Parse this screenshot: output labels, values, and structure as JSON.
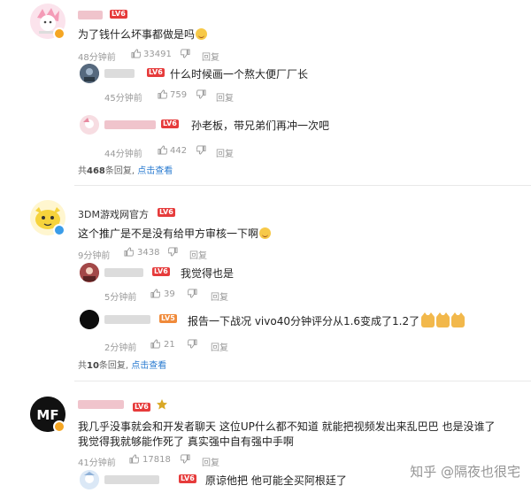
{
  "thread1": {
    "comment": "为了钱什么坏事都做是吗",
    "time": "48分钟前",
    "likes": "33491",
    "reply_label": "回复",
    "replies": [
      {
        "text": "什么时候画一个熬大便厂厂长",
        "time": "45分钟前",
        "likes": "759",
        "reply_label": "回复",
        "level": "LV6"
      },
      {
        "text": "孙老板，带兄弟们再冲一次吧",
        "time": "44分钟前",
        "likes": "442",
        "reply_label": "回复",
        "level": "LV6"
      }
    ],
    "level": "LV6",
    "summary_prefix": "共",
    "summary_count": "468",
    "summary_suffix": "条回复,",
    "summary_link": "点击查看"
  },
  "thread2": {
    "username": "3DM游戏网官方",
    "level": "LV6",
    "comment": "这个推广是不是没有给甲方审核一下啊",
    "time": "9分钟前",
    "likes": "3438",
    "reply_label": "回复",
    "replies": [
      {
        "text": "我觉得也是",
        "time": "5分钟前",
        "likes": "39",
        "reply_label": "回复",
        "level": "LV6"
      },
      {
        "text": "报告一下战况 vivo40分钟评分从1.6变成了1.2了",
        "time": "2分钟前",
        "likes": "21",
        "reply_label": "回复",
        "level": "LV5"
      }
    ],
    "summary_prefix": "共",
    "summary_count": "10",
    "summary_suffix": "条回复,",
    "summary_link": "点击查看"
  },
  "thread3": {
    "level": "LV6",
    "comment_line1": "我几乎没事就会和开发者聊天   这位UP什么都不知道 就能把视频发出来乱巴巴   也是没谁了",
    "comment_line2": "我觉得我就够能作死了  真实强中自有强中手啊",
    "time": "41分钟前",
    "likes": "17818",
    "reply_label": "回复",
    "avatar_text": "MF",
    "replies": [
      {
        "text": "原谅他把 他可能全买阿根廷了",
        "level": "LV6"
      }
    ]
  },
  "watermark": "知乎 @隔夜也很宅",
  "colors": {
    "link": "#2a7bd0",
    "level_badge": "#e85a5a",
    "meta": "#999999"
  }
}
